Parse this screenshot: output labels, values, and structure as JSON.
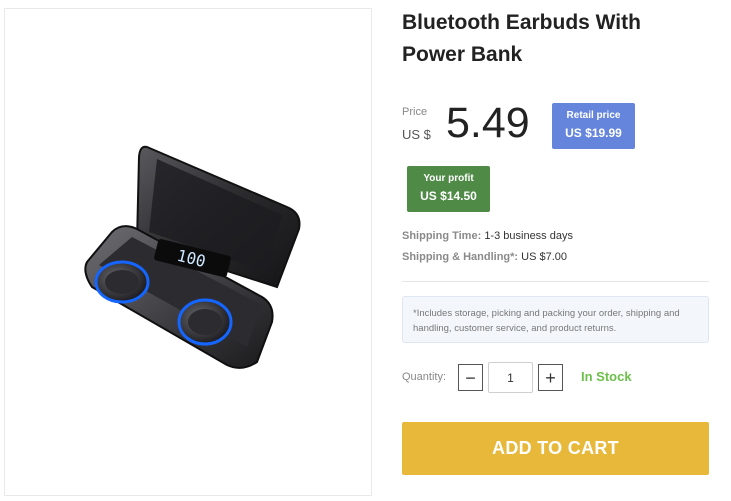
{
  "product": {
    "title": "Bluetooth Earbuds With Power Bank",
    "image_alt": "earbuds-charging-case"
  },
  "price": {
    "label": "Price",
    "currency": "US $",
    "value": "5.49"
  },
  "retail": {
    "label": "Retail price",
    "value": "US $19.99"
  },
  "profit": {
    "label": "Your profit",
    "value": "US $14.50"
  },
  "shipping": {
    "time_label": "Shipping Time:",
    "time_value": "1-3 business days",
    "handling_label": "Shipping & Handling*:",
    "handling_value": "US $7.00"
  },
  "note": "*Includes storage, picking and packing your order, shipping and handling, customer service, and product returns.",
  "quantity": {
    "label": "Quantity:",
    "minus": "−",
    "plus": "+",
    "value": "1"
  },
  "stock_status": "In Stock",
  "cart_button": "ADD TO CART",
  "colors": {
    "retail_badge": "#6585dc",
    "profit_badge": "#4f8a47",
    "in_stock": "#6cbf4a",
    "cart_button": "#e8b83a"
  }
}
